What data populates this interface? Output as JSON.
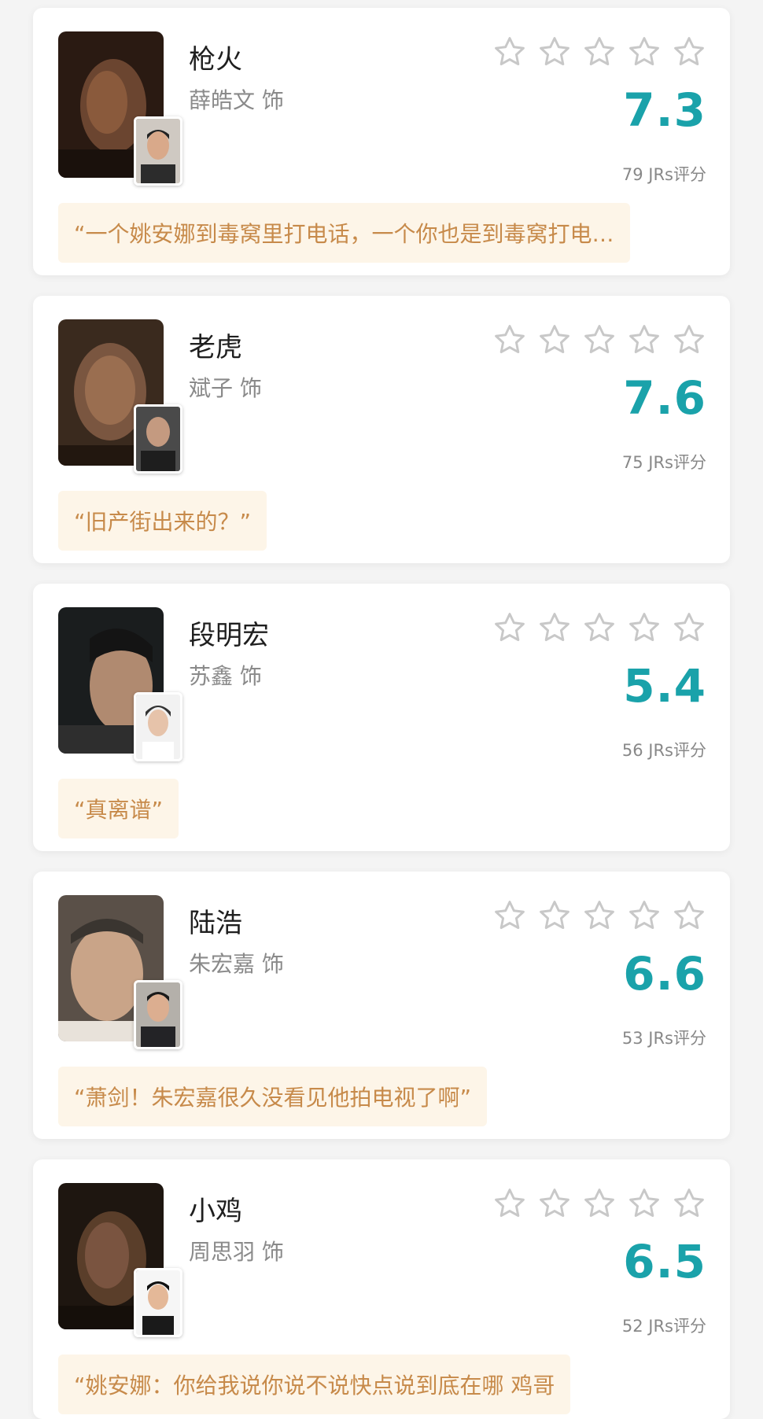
{
  "colors": {
    "background": "#f4f4f4",
    "card": "#ffffff",
    "score": "#1aa2aa",
    "quote_bg": "#fdf5e8",
    "quote_text": "#c78a4a",
    "star_outline": "#c8c8c8"
  },
  "cards": [
    {
      "role": "枪火",
      "actor": "薛皓文 饰",
      "score": "7.3",
      "count": "79 JRs评分",
      "quote": "“一个姚安娜到毒窝里打电话，一个你也是到毒窝打电…",
      "poster_icon": "character-photo",
      "avatar_icon": "actor-photo"
    },
    {
      "role": "老虎",
      "actor": "斌子 饰",
      "score": "7.6",
      "count": "75 JRs评分",
      "quote": "“旧产街出来的？”",
      "poster_icon": "character-photo",
      "avatar_icon": "actor-photo"
    },
    {
      "role": "段明宏",
      "actor": "苏鑫 饰",
      "score": "5.4",
      "count": "56 JRs评分",
      "quote": "“真离谱”",
      "poster_icon": "character-photo",
      "avatar_icon": "actor-photo"
    },
    {
      "role": "陆浩",
      "actor": "朱宏嘉 饰",
      "score": "6.6",
      "count": "53 JRs评分",
      "quote": "“萧剑！朱宏嘉很久没看见他拍电视了啊”",
      "poster_icon": "character-photo",
      "avatar_icon": "actor-photo"
    },
    {
      "role": "小鸡",
      "actor": "周思羽 饰",
      "score": "6.5",
      "count": "52 JRs评分",
      "quote": "“姚安娜：你给我说你说不说快点说到底在哪 鸡哥",
      "poster_icon": "character-photo",
      "avatar_icon": "actor-photo"
    }
  ]
}
